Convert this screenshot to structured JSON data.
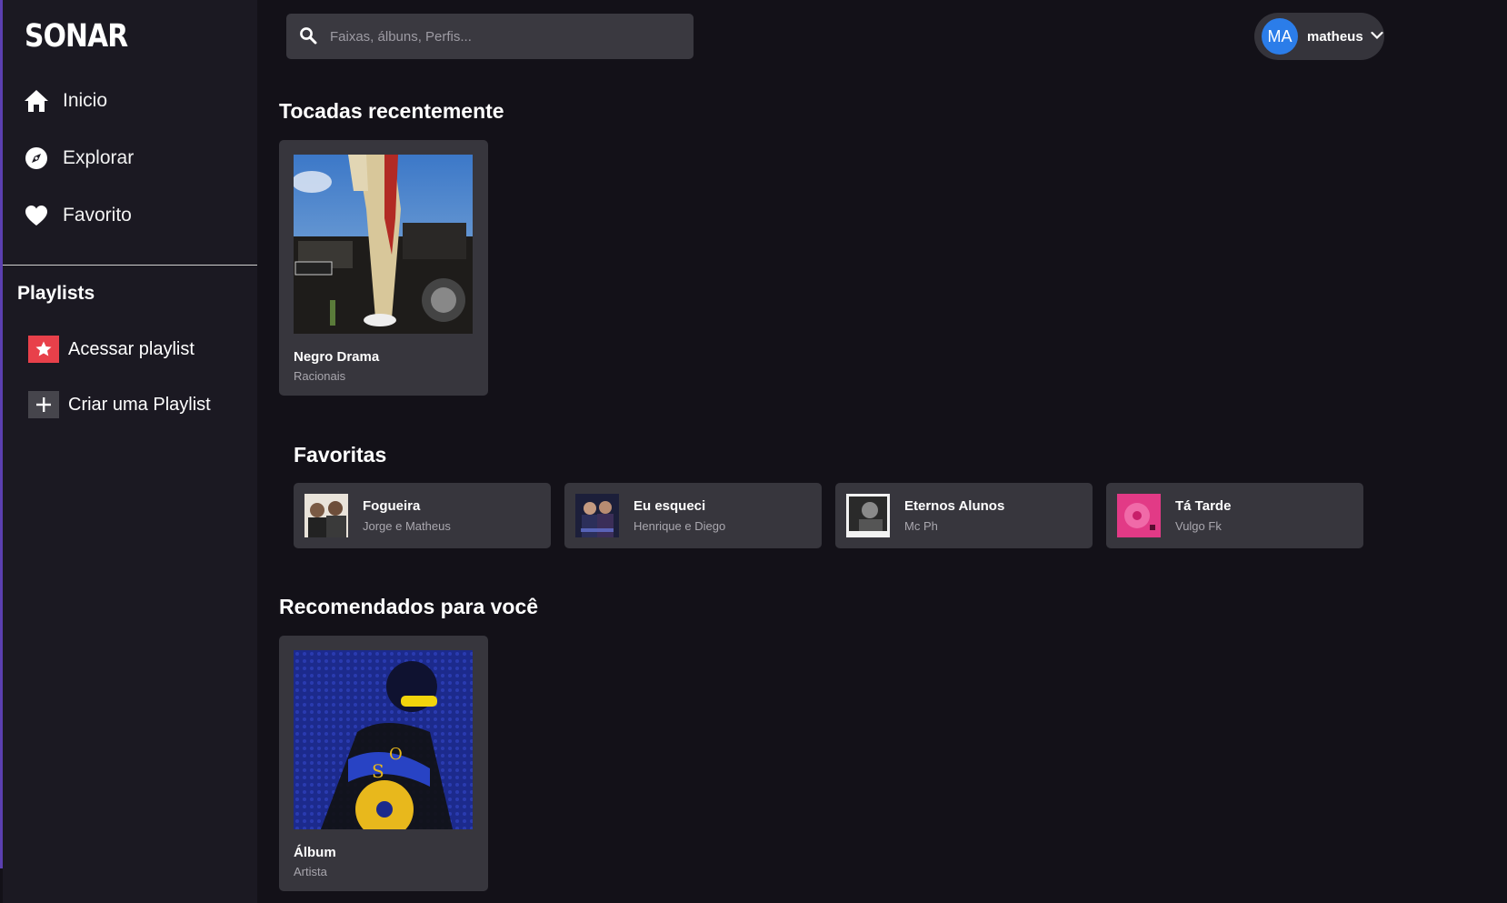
{
  "app": {
    "logo": "SONAR"
  },
  "sidebar": {
    "nav": [
      {
        "label": "Inicio",
        "icon": "home-icon"
      },
      {
        "label": "Explorar",
        "icon": "compass-icon"
      },
      {
        "label": "Favorito",
        "icon": "heart-icon"
      }
    ],
    "playlists_heading": "Playlists",
    "playlist_items": [
      {
        "label": "Acessar playlist",
        "icon": "star-icon"
      },
      {
        "label": "Criar uma Playlist",
        "icon": "plus-icon"
      }
    ]
  },
  "search": {
    "placeholder": "Faixas, álbuns, Perfis..."
  },
  "user": {
    "initials": "MA",
    "name": "matheus"
  },
  "recent": {
    "title": "Tocadas recentemente",
    "items": [
      {
        "title": "Negro Drama",
        "subtitle": "Racionais"
      }
    ]
  },
  "favorites": {
    "title": "Favoritas",
    "items": [
      {
        "title": "Fogueira",
        "subtitle": "Jorge e Matheus"
      },
      {
        "title": "Eu esqueci",
        "subtitle": "Henrique e Diego"
      },
      {
        "title": "Eternos Alunos",
        "subtitle": "Mc Ph"
      },
      {
        "title": "Tá Tarde",
        "subtitle": "Vulgo Fk"
      }
    ]
  },
  "recommended": {
    "title": "Recomendados para você",
    "items": [
      {
        "title": "Álbum",
        "subtitle": "Artista"
      }
    ]
  },
  "colors": {
    "background": "#131118",
    "sidebar": "#1b1922",
    "card": "#37363d",
    "accent_avatar": "#2b7de9",
    "playlist_star": "#e8404a"
  }
}
